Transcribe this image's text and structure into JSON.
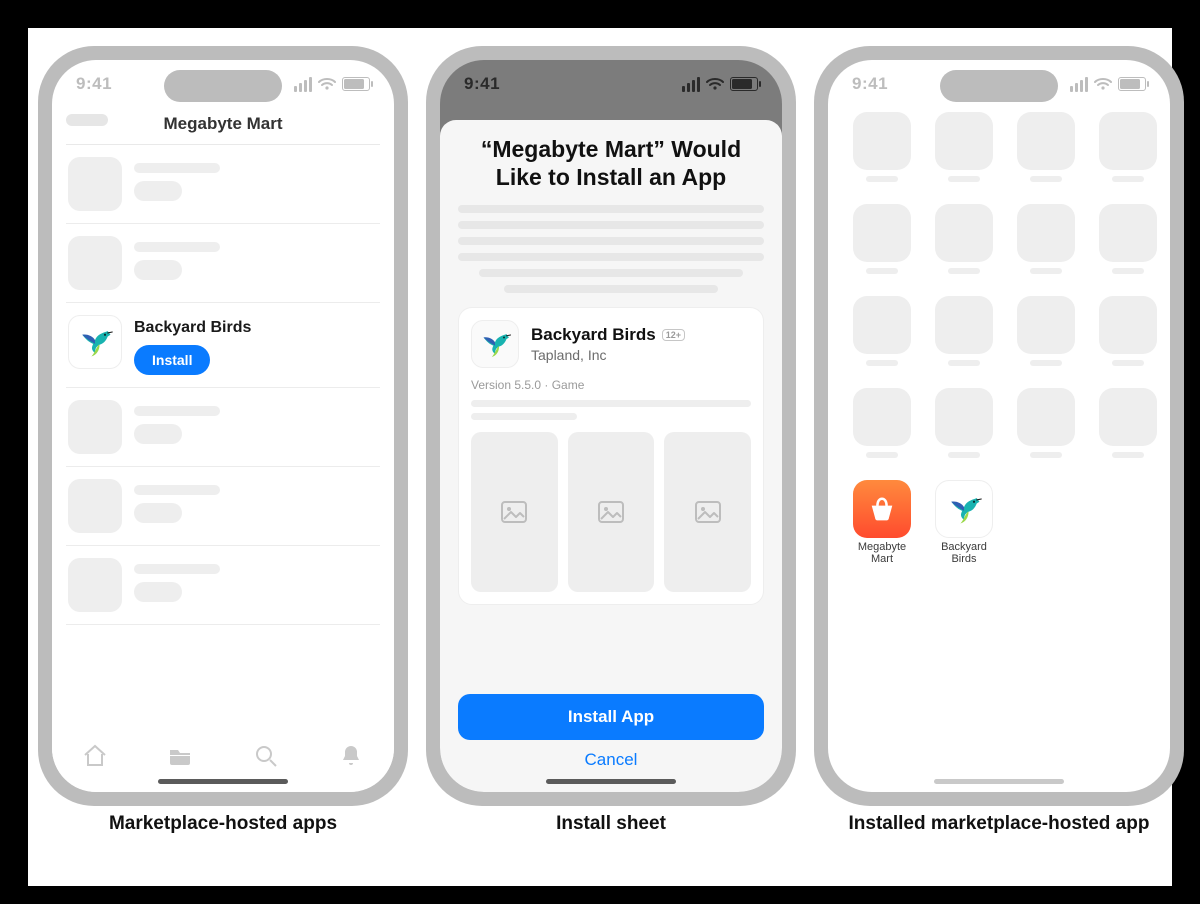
{
  "captions": {
    "phone1": "Marketplace-hosted apps",
    "phone2": "Install sheet",
    "phone3": "Installed marketplace-hosted app"
  },
  "status": {
    "time": "9:41"
  },
  "marketplace": {
    "title": "Megabyte Mart",
    "featured_app": {
      "name": "Backyard Birds",
      "install_label": "Install"
    }
  },
  "sheet": {
    "title": "“Megabyte Mart” Would Like to Install an App",
    "app_name": "Backyard Birds",
    "developer": "Tapland, Inc",
    "age": "12+",
    "meta": "Version 5.5.0 · Game",
    "install_label": "Install App",
    "cancel_label": "Cancel"
  },
  "home": {
    "apps": [
      {
        "name": "Megabyte Mart"
      },
      {
        "name": "Backyard Birds"
      }
    ]
  }
}
